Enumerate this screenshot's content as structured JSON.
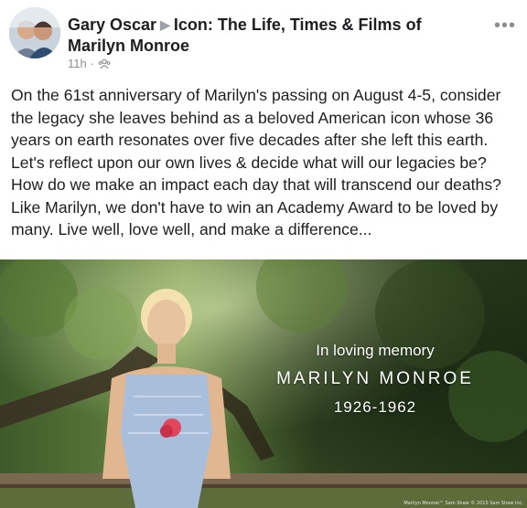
{
  "post": {
    "author": "Gary Oscar",
    "group": "Icon: The Life, Times & Films of Marilyn Monroe",
    "time": "11h",
    "separator": "·",
    "privacy_icon": "group-icon",
    "more_icon": "more-options-icon",
    "more_glyph": "•••",
    "text": "On the 61st anniversary of Marilyn's passing on August 4-5, consider the legacy she leaves behind as a beloved American icon whose 36 years on earth resonates over five decades after she left this earth. Let's reflect upon our own lives & decide what will our legacies be? How do we make an impact each day that will transcend our deaths? Like Marilyn, we don't have to win an Academy Award to be loved by many. Live well, love well, and make a difference..."
  },
  "photo": {
    "line1": "In loving memory",
    "line2": "MARILYN MONROE",
    "line3": "1926-1962",
    "credit": "Marilyn Monroe™ Sam Shaw © 2015 Sam Shaw Inc."
  },
  "colors": {
    "name_text": "#1c1e21",
    "meta_text": "#8a8d91",
    "overlay_text": "#ffffff"
  }
}
